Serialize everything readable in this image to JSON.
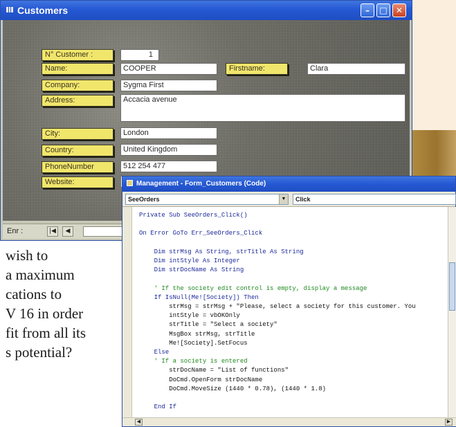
{
  "customers_window": {
    "title": "Customers",
    "fields": {
      "customer_no": {
        "label": "N° Customer :",
        "value": "1"
      },
      "name": {
        "label": "Name:",
        "value": "COOPER"
      },
      "firstname": {
        "label": "Firstname:",
        "value": "Clara"
      },
      "company": {
        "label": "Company:",
        "value": "Sygma First"
      },
      "address": {
        "label": "Address:",
        "value": "Accacia avenue"
      },
      "city": {
        "label": "City:",
        "value": "London"
      },
      "country": {
        "label": "Country:",
        "value": "United Kingdom"
      },
      "phone": {
        "label": "PhoneNumber",
        "value": "512 254 477"
      },
      "website": {
        "label": "Website:",
        "value": ""
      }
    },
    "nav": {
      "label": "Enr :",
      "first_icon": "|◀",
      "prev_icon": "◀"
    }
  },
  "code_window": {
    "title": "Management - Form_Customers (Code)",
    "object_combo": "SeeOrders",
    "procedure_combo": "Click",
    "lines": [
      {
        "text": "Private Sub SeeOrders_Click()",
        "kind": "kw"
      },
      {
        "text": "",
        "kind": "tx"
      },
      {
        "text": "On Error GoTo Err_SeeOrders_Click",
        "kind": "kw"
      },
      {
        "text": "",
        "kind": "tx"
      },
      {
        "text": "    Dim strMsg As String, strTitle As String",
        "kind": "kw"
      },
      {
        "text": "    Dim intStyle As Integer",
        "kind": "kw"
      },
      {
        "text": "    Dim strDocName As String",
        "kind": "kw"
      },
      {
        "text": "",
        "kind": "tx"
      },
      {
        "text": "    ' If the society edit control is empty, display a message",
        "kind": "cm"
      },
      {
        "text": "    If IsNull(Me![Society]) Then",
        "kind": "kw"
      },
      {
        "text": "        strMsg = strMsg + \"Please, select a society for this customer. You",
        "kind": "tx"
      },
      {
        "text": "        intStyle = vbOKOnly",
        "kind": "tx"
      },
      {
        "text": "        strTitle = \"Select a society\"",
        "kind": "tx"
      },
      {
        "text": "        MsgBox strMsg, strTitle",
        "kind": "tx"
      },
      {
        "text": "        Me![Society].SetFocus",
        "kind": "tx"
      },
      {
        "text": "    Else",
        "kind": "kw"
      },
      {
        "text": "    ' If a society is entered",
        "kind": "cm"
      },
      {
        "text": "        strDocName = \"List of functions\"",
        "kind": "tx"
      },
      {
        "text": "        DoCmd.OpenForm strDocName",
        "kind": "tx"
      },
      {
        "text": "        DoCmd.MoveSize (1440 * 0.78), (1440 * 1.8)",
        "kind": "tx"
      },
      {
        "text": "",
        "kind": "tx"
      },
      {
        "text": "    End If",
        "kind": "kw"
      }
    ]
  },
  "article_fragments": [
    "wish to",
    "a maximum",
    "cations to",
    "V 16 in order",
    "fit from all its",
    "s potential?"
  ],
  "colors": {
    "title_bar": "#2558d3",
    "label_bg": "#f1e66c",
    "form_bg": "#6d6d66",
    "code_keyword": "#1d2a9a",
    "code_comment": "#1f8a1f",
    "peach_bg": "#fbeedd"
  }
}
